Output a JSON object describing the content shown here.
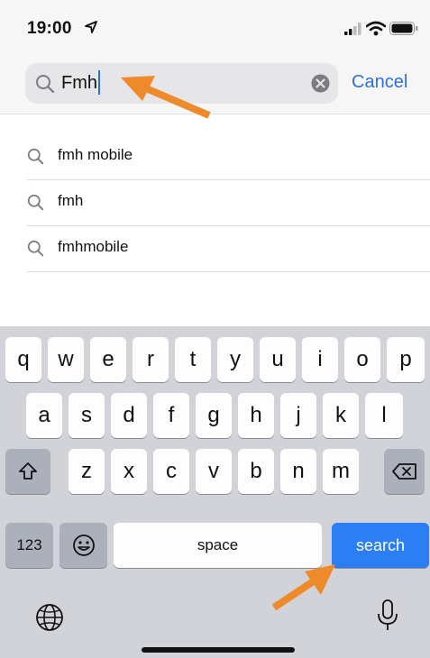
{
  "status_bar": {
    "time": "19:00"
  },
  "search": {
    "value": "Fmh",
    "cancel_label": "Cancel"
  },
  "suggestions": [
    {
      "label": "fmh mobile"
    },
    {
      "label": "fmh"
    },
    {
      "label": "fmhmobile"
    }
  ],
  "keyboard": {
    "row1": [
      "q",
      "w",
      "e",
      "r",
      "t",
      "y",
      "u",
      "i",
      "o",
      "p"
    ],
    "row2": [
      "a",
      "s",
      "d",
      "f",
      "g",
      "h",
      "j",
      "k",
      "l"
    ],
    "row3": [
      "z",
      "x",
      "c",
      "v",
      "b",
      "n",
      "m"
    ],
    "numbers_label": "123",
    "space_label": "space",
    "search_label": "search"
  },
  "annotations": {
    "arrow_color": "#ee8a2a"
  },
  "colors": {
    "accent": "#2f6fd8",
    "search_key": "#2b7ef5"
  }
}
